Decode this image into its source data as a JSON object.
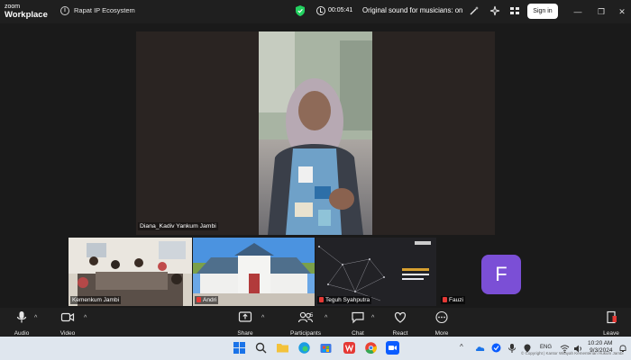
{
  "app": {
    "logo_line1": "zoom",
    "logo_line2": "Workplace",
    "meeting_title": "Rapat IP Ecosystem",
    "timer": "00:05:41",
    "original_sound": "Original sound for musicians: on",
    "signin_label": "Sign in"
  },
  "speaker": {
    "name": "Diana_Kadiv Yankum Jambi"
  },
  "gallery": [
    {
      "name": "Kemenkum Jambi"
    },
    {
      "name": "Andri"
    },
    {
      "name": "Teguh Syahputra"
    },
    {
      "name": "Fauzi",
      "avatar_letter": "F"
    }
  ],
  "toolbar": {
    "audio": "Audio",
    "video": "Video",
    "share": "Share",
    "participants": "Participants",
    "participants_count": "5",
    "chat": "Chat",
    "react": "React",
    "more": "More",
    "leave": "Leave"
  },
  "taskbar": {
    "language": "ENG",
    "time": "10:20 AM",
    "date": "9/3/2024",
    "copyright": "© Copyright | Kantor Wilayah Kementerian Hukum Jambi"
  },
  "colors": {
    "zoom_blue": "#0b5cff",
    "avatar_purple": "#7b4fd6",
    "leave_red": "#e53935",
    "shield_green": "#23d160"
  }
}
